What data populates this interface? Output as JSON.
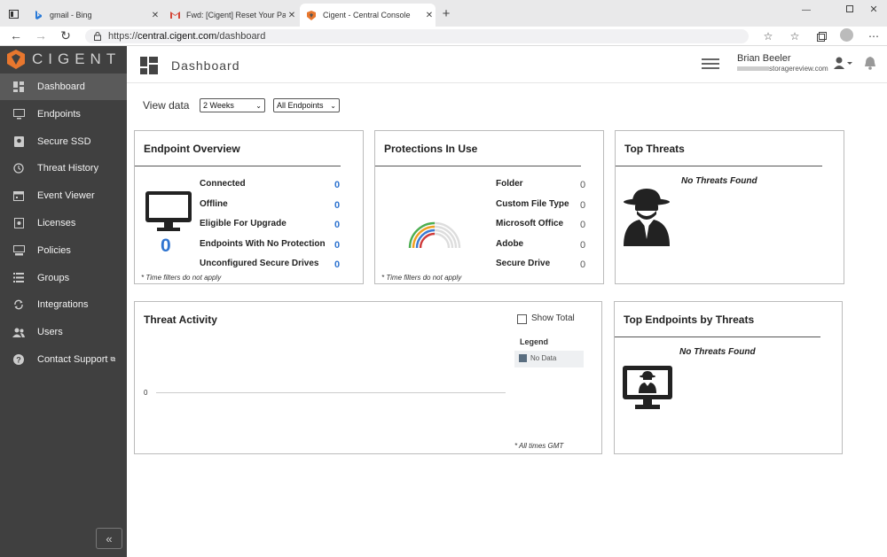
{
  "browser": {
    "tabs": [
      {
        "title": "gmail - Bing"
      },
      {
        "title": "Fwd: [Cigent] Reset Your Passwo"
      },
      {
        "title": "Cigent - Central Console"
      }
    ],
    "url_prefix": "https://",
    "url_domain": "central.cigent.com",
    "url_path": "/dashboard"
  },
  "brand": {
    "name": "CIGENT",
    "accent": "#e8772e"
  },
  "sidebar": {
    "items": [
      {
        "label": "Dashboard",
        "icon": "dashboard-icon"
      },
      {
        "label": "Endpoints",
        "icon": "monitor-icon"
      },
      {
        "label": "Secure SSD",
        "icon": "ssd-icon"
      },
      {
        "label": "Threat History",
        "icon": "history-icon"
      },
      {
        "label": "Event Viewer",
        "icon": "calendar-icon"
      },
      {
        "label": "Licenses",
        "icon": "license-icon"
      },
      {
        "label": "Policies",
        "icon": "policy-icon"
      },
      {
        "label": "Groups",
        "icon": "list-icon"
      },
      {
        "label": "Integrations",
        "icon": "sync-icon"
      },
      {
        "label": "Users",
        "icon": "users-icon"
      },
      {
        "label": "Contact Support",
        "icon": "help-icon"
      }
    ],
    "collapse_glyph": "«"
  },
  "header": {
    "title": "Dashboard",
    "user_name": "Brian Beeler",
    "user_email": "storagereview.com"
  },
  "filters": {
    "label": "View data",
    "period": "2 Weeks",
    "endpoints": "All Endpoints"
  },
  "endpoint_overview": {
    "title": "Endpoint Overview",
    "count": "0",
    "rows": [
      {
        "label": "Connected",
        "value": "0"
      },
      {
        "label": "Offline",
        "value": "0"
      },
      {
        "label": "Eligible For Upgrade",
        "value": "0"
      },
      {
        "label": "Endpoints With No Protection",
        "value": "0"
      },
      {
        "label": "Unconfigured Secure Drives",
        "value": "0"
      }
    ],
    "note": "* Time filters do not apply"
  },
  "protections": {
    "title": "Protections In Use",
    "rows": [
      {
        "label": "Folder",
        "value": "0"
      },
      {
        "label": "Custom File Type",
        "value": "0"
      },
      {
        "label": "Microsoft Office",
        "value": "0"
      },
      {
        "label": "Adobe",
        "value": "0"
      },
      {
        "label": "Secure Drive",
        "value": "0"
      }
    ],
    "ring_colors": [
      "#4caf50",
      "#f0a020",
      "#3a7bd5",
      "#d03a3a"
    ],
    "note": "* Time filters do not apply"
  },
  "top_threats": {
    "title": "Top Threats",
    "empty": "No Threats Found"
  },
  "threat_activity": {
    "title": "Threat Activity",
    "show_total": "Show Total",
    "legend_title": "Legend",
    "legend_item": "No Data",
    "legend_color": "#5a6e80",
    "y_tick": "0",
    "note": "* All times GMT"
  },
  "top_endpoints": {
    "title": "Top Endpoints by Threats",
    "empty": "No Threats Found"
  }
}
